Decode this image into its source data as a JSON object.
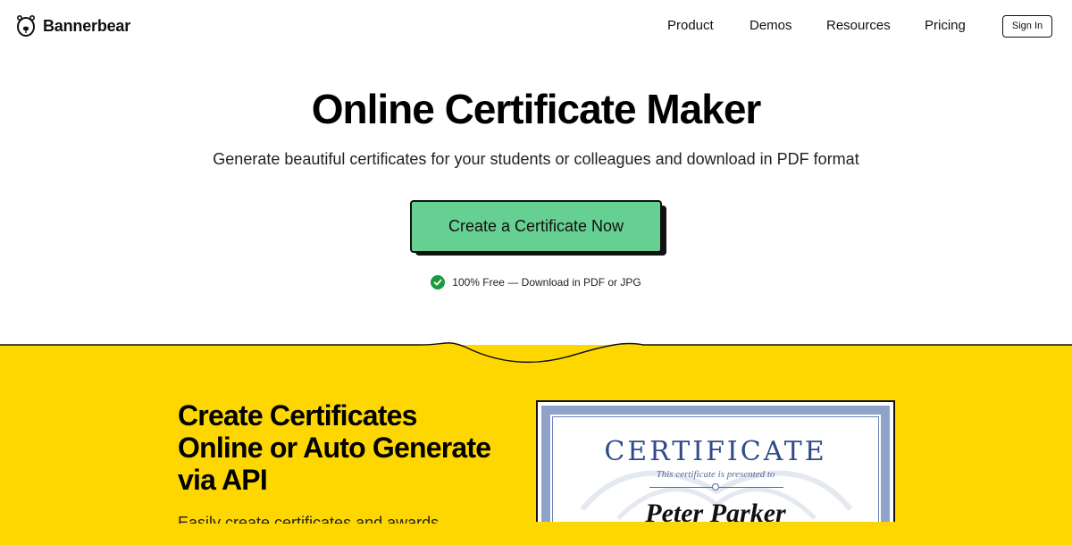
{
  "brand": {
    "name": "Bannerbear",
    "icon": "bear-logo-icon"
  },
  "nav": {
    "links": [
      "Product",
      "Demos",
      "Resources",
      "Pricing"
    ],
    "sign_in": "Sign In"
  },
  "hero": {
    "title": "Online Certificate Maker",
    "subtitle": "Generate beautiful certificates for your students or colleagues and download in PDF format",
    "cta": "Create a Certificate Now",
    "free_note": "100% Free — Download in PDF or JPG",
    "check_icon": "check-circle-icon"
  },
  "section": {
    "title_lines": [
      "Create Certificates",
      "Online or Auto Generate",
      "via API"
    ],
    "text": "Easily create certificates and awards"
  },
  "certificate": {
    "title": "CERTIFICATE",
    "presented": "This certificate is presented to",
    "name": "Peter Parker"
  },
  "colors": {
    "accent_green": "#66d092",
    "yellow": "#ffd700",
    "check_green": "#1a9a3a",
    "cert_blue": "#2e4a8a"
  }
}
